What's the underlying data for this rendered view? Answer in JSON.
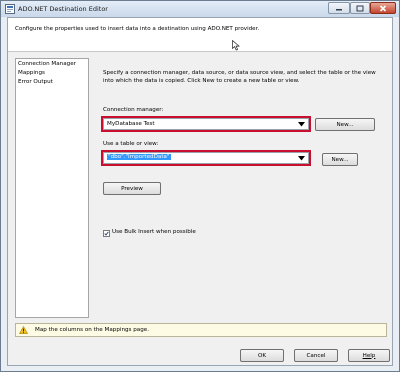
{
  "window": {
    "title": "ADO.NET Destination Editor"
  },
  "description": "Configure the properties used to insert data into a destination using ADO.NET provider.",
  "nav": {
    "items": [
      "Connection Manager",
      "Mappings",
      "Error Output"
    ]
  },
  "intro": "Specify a connection manager, data source, or data source view, and select the table or the view into which the data is copied. Click New to create a new table or view.",
  "connection": {
    "label": "Connection manager:",
    "value": "MyDatabase Test",
    "new_button": "New..."
  },
  "table": {
    "label": "Use a table or view:",
    "value": "\"dbo\".\"ImportedData\"",
    "new_button": "New..."
  },
  "preview_button": "Preview",
  "bulk_insert": {
    "label": "Use Bulk Insert when possible",
    "checked": true
  },
  "message": "Map the columns on the Mappings page.",
  "footer": {
    "ok": "OK",
    "cancel": "Cancel",
    "help": "Help"
  },
  "colors": {
    "highlight": "#c8102e",
    "selection": "#3399ff"
  }
}
